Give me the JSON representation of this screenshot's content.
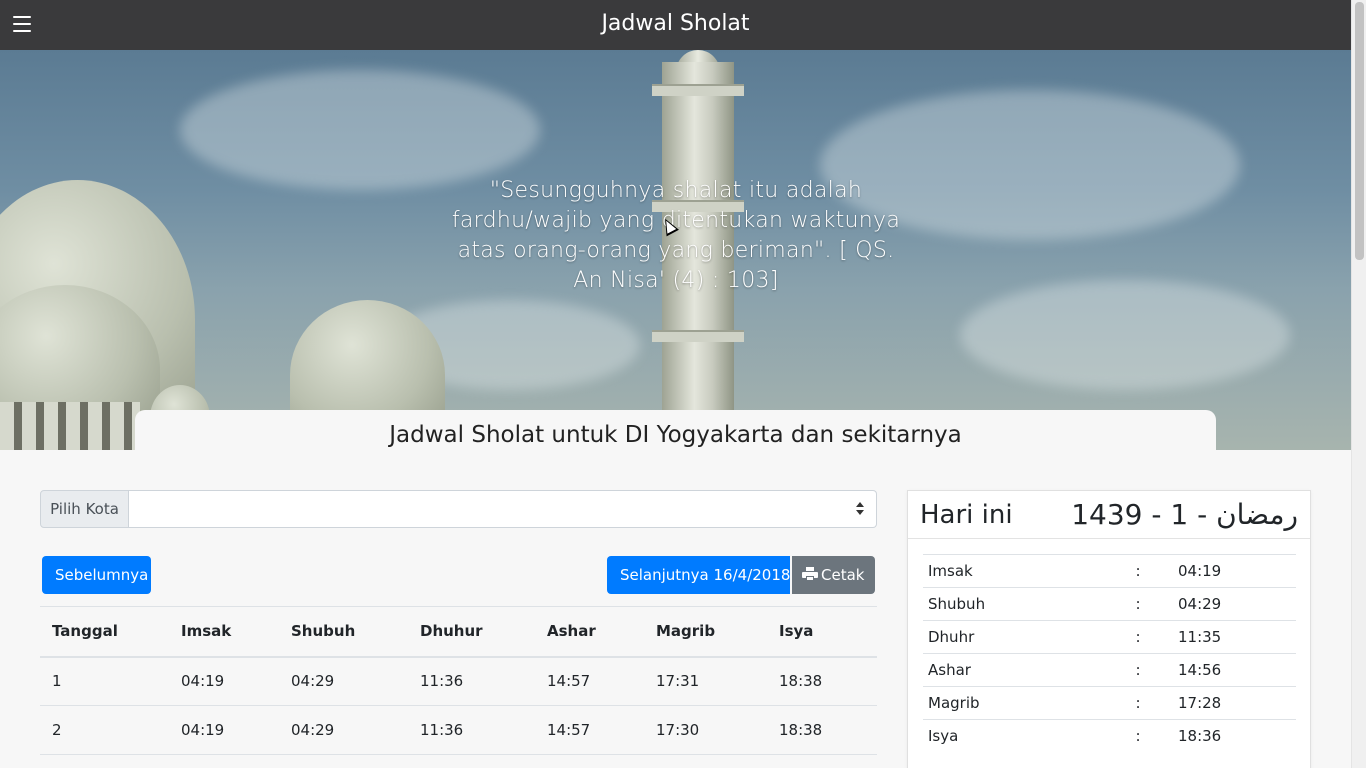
{
  "navbar": {
    "title": "Jadwal Sholat",
    "menu_icon": "hamburger-menu-icon"
  },
  "hero": {
    "quote": "\"Sesungguhnya shalat itu adalah fardhu/wajib yang ditentukan waktunya atas orang-orang yang beriman\". [ QS. An Nisa' (4) : 103]"
  },
  "page_title": "Jadwal Sholat untuk DI Yogyakarta dan sekitarnya",
  "city_select": {
    "label": "Pilih Kota",
    "value": ""
  },
  "buttons": {
    "prev": "Sebelumnya",
    "next": "Selanjutnya 16/4/2018",
    "print": "Cetak",
    "print_icon": "printer-icon"
  },
  "schedule": {
    "headers": [
      "Tanggal",
      "Imsak",
      "Shubuh",
      "Dhuhur",
      "Ashar",
      "Magrib",
      "Isya"
    ],
    "rows": [
      [
        "1",
        "04:19",
        "04:29",
        "11:36",
        "14:57",
        "17:31",
        "18:38"
      ],
      [
        "2",
        "04:19",
        "04:29",
        "11:36",
        "14:57",
        "17:30",
        "18:38"
      ]
    ]
  },
  "today": {
    "label": "Hari ini",
    "hijri_date": "1439 - 1 - رمضان",
    "separator": ":",
    "times": [
      {
        "name": "Imsak",
        "time": "04:19"
      },
      {
        "name": "Shubuh",
        "time": "04:29"
      },
      {
        "name": "Dhuhr",
        "time": "11:35"
      },
      {
        "name": "Ashar",
        "time": "14:56"
      },
      {
        "name": "Magrib",
        "time": "17:28"
      },
      {
        "name": "Isya",
        "time": "18:36"
      }
    ]
  },
  "colors": {
    "navbar": "#3a3a3c",
    "primary": "#007bff",
    "secondary": "#6c757d"
  }
}
